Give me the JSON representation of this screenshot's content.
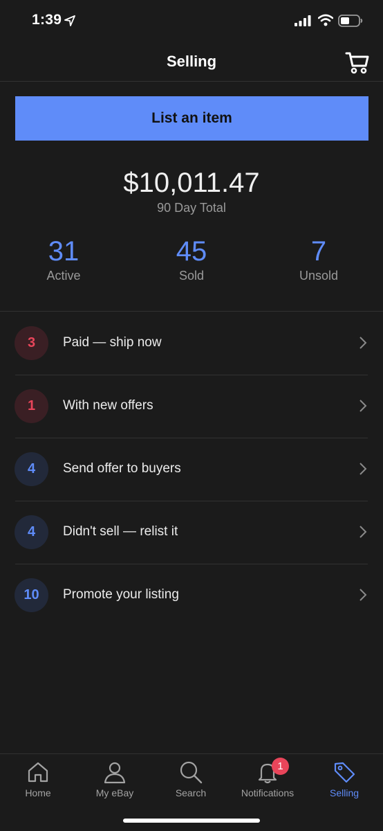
{
  "status_bar": {
    "time": "1:39",
    "icons": [
      "location-arrow-icon",
      "signal-icon",
      "wifi-icon",
      "battery-icon"
    ]
  },
  "header": {
    "title": "Selling",
    "cart_icon": "cart-icon"
  },
  "list_button": {
    "label": "List an item"
  },
  "summary": {
    "total": "$10,011.47",
    "caption": "90 Day Total",
    "stats": [
      {
        "value": "31",
        "label": "Active"
      },
      {
        "value": "45",
        "label": "Sold"
      },
      {
        "value": "7",
        "label": "Unsold"
      }
    ]
  },
  "actions": [
    {
      "count": "3",
      "label": "Paid — ship now",
      "color": "#e8455a"
    },
    {
      "count": "1",
      "label": "With new offers",
      "color": "#e8455a"
    },
    {
      "count": "4",
      "label": "Send offer to buyers",
      "color": "#5f8cf9"
    },
    {
      "count": "4",
      "label": "Didn't sell — relist it",
      "color": "#5f8cf9"
    },
    {
      "count": "10",
      "label": "Promote your listing",
      "color": "#5f8cf9"
    }
  ],
  "tabs": [
    {
      "label": "Home",
      "icon": "home-icon"
    },
    {
      "label": "My eBay",
      "icon": "person-icon"
    },
    {
      "label": "Search",
      "icon": "search-icon"
    },
    {
      "label": "Notifications",
      "icon": "bell-icon",
      "badge": "1"
    },
    {
      "label": "Selling",
      "icon": "tag-icon",
      "active": true
    }
  ],
  "colors": {
    "accent": "#5f8cf9",
    "alert": "#e8455a",
    "background": "#1b1b1b"
  }
}
